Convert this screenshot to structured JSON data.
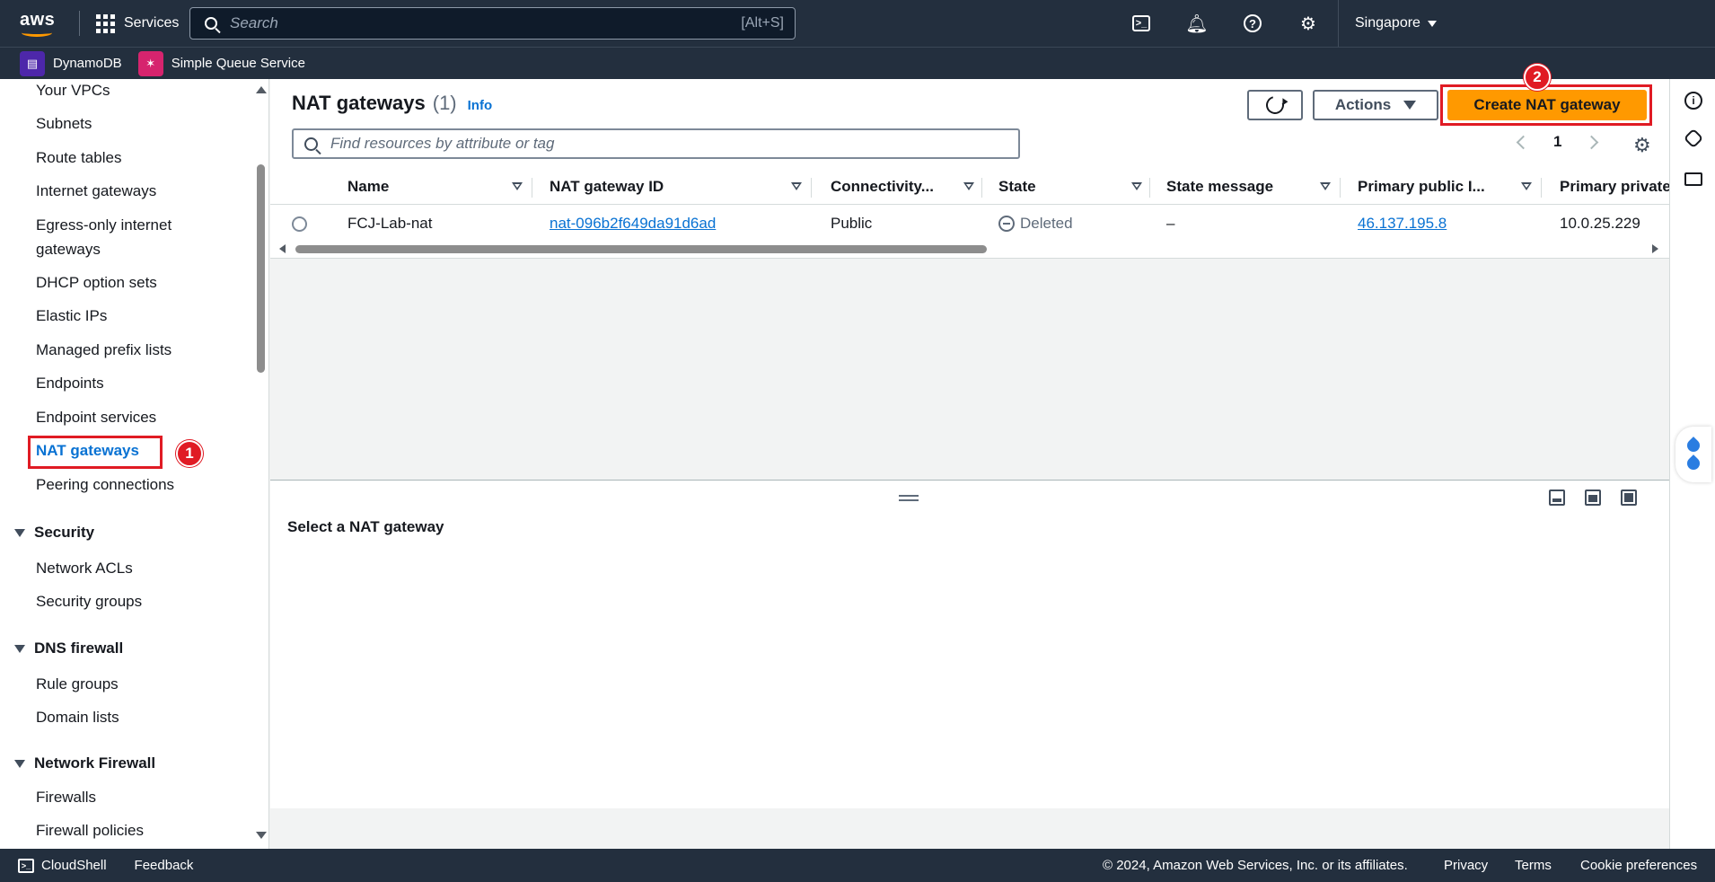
{
  "topbar": {
    "logo": "aws",
    "services_label": "Services",
    "search_placeholder": "Search",
    "search_shortcut": "[Alt+S]",
    "region": "Singapore",
    "icons": [
      "cloudshell-icon",
      "bell-icon",
      "help-icon",
      "gear-icon"
    ]
  },
  "favorites": [
    {
      "label": "DynamoDB",
      "icon": "dynamodb-icon",
      "color": "#4d27aa"
    },
    {
      "label": "Simple Queue Service",
      "icon": "sqs-icon",
      "color": "#d6246e"
    }
  ],
  "sidebar": {
    "items": [
      {
        "label": "Your VPCs"
      },
      {
        "label": "Subnets"
      },
      {
        "label": "Route tables"
      },
      {
        "label": "Internet gateways"
      },
      {
        "label": "Egress-only internet gateways"
      },
      {
        "label": "DHCP option sets"
      },
      {
        "label": "Elastic IPs"
      },
      {
        "label": "Managed prefix lists"
      },
      {
        "label": "Endpoints"
      },
      {
        "label": "Endpoint services"
      },
      {
        "label": "NAT gateways",
        "active": true
      },
      {
        "label": "Peering connections"
      }
    ],
    "sections": [
      {
        "title": "Security",
        "items": [
          "Network ACLs",
          "Security groups"
        ]
      },
      {
        "title": "DNS firewall",
        "items": [
          "Rule groups",
          "Domain lists"
        ]
      },
      {
        "title": "Network Firewall",
        "items": [
          "Firewalls",
          "Firewall policies"
        ]
      }
    ]
  },
  "annotations": {
    "step1": "1",
    "step2": "2",
    "color": "#e01b24"
  },
  "main": {
    "title": "NAT gateways",
    "count": "(1)",
    "info": "Info",
    "actions_label": "Actions",
    "create_label": "Create NAT gateway",
    "filter_placeholder": "Find resources by attribute or tag",
    "page": "1",
    "columns": [
      "Name",
      "NAT gateway ID",
      "Connectivity...",
      "State",
      "State message",
      "Primary public I...",
      "Primary private"
    ],
    "rows": [
      {
        "name": "FCJ-Lab-nat",
        "id": "nat-096b2f649da91d6ad",
        "connectivity": "Public",
        "state": "Deleted",
        "state_message": "–",
        "public_ip": "46.137.195.8",
        "private_ip": "10.0.25.229"
      }
    ],
    "detail_title": "Select a NAT gateway",
    "accent_color": "#ff9900",
    "link_color": "#0972d3"
  },
  "footer": {
    "cloudshell": "CloudShell",
    "feedback": "Feedback",
    "copyright": "© 2024, Amazon Web Services, Inc. or its affiliates.",
    "privacy": "Privacy",
    "terms": "Terms",
    "cookies": "Cookie preferences"
  }
}
